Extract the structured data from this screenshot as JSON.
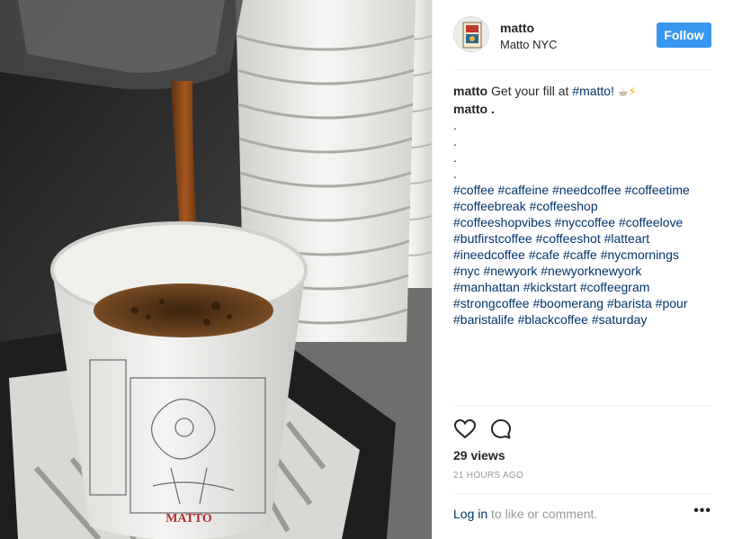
{
  "post": {
    "username": "matto",
    "location": "Matto NYC",
    "follow_label": "Follow",
    "caption": {
      "username": "matto",
      "text": "Get your fill at",
      "hashtag": "#matto!",
      "emoji_coffee": "☕",
      "emoji_bolt": "⚡",
      "line2": "matto .",
      "dots": [
        ".",
        ".",
        ".",
        "."
      ],
      "hashtag_lines": [
        "#coffee #caffeine #needcoffee #coffeetime",
        "#coffeebreak #coffeeshop",
        "#coffeeshopvibes #nyccoffee #coffeelove",
        "#butfirstcoffee #coffeeshot #latteart",
        "#ineedcoffee #cafe #caffe #nycmornings",
        "#nyc #newyork #newyorknewyork",
        "#manhattan #kickstart #coffeegram",
        "#strongcoffee #boomerang #barista #pour",
        "#baristalife #blackcoffee #saturday"
      ]
    },
    "icons": {
      "like": "heart-icon",
      "comment": "comment-icon",
      "more": "more-options-icon"
    },
    "views": "29 views",
    "timestamp": "21 HOURS AGO",
    "login": {
      "link": "Log in",
      "rest": "to like or comment."
    },
    "more_label": "•••",
    "cup_logo": "MATTO",
    "colors": {
      "follow": "#3897f0",
      "link": "#003569",
      "muted": "#999999"
    }
  }
}
